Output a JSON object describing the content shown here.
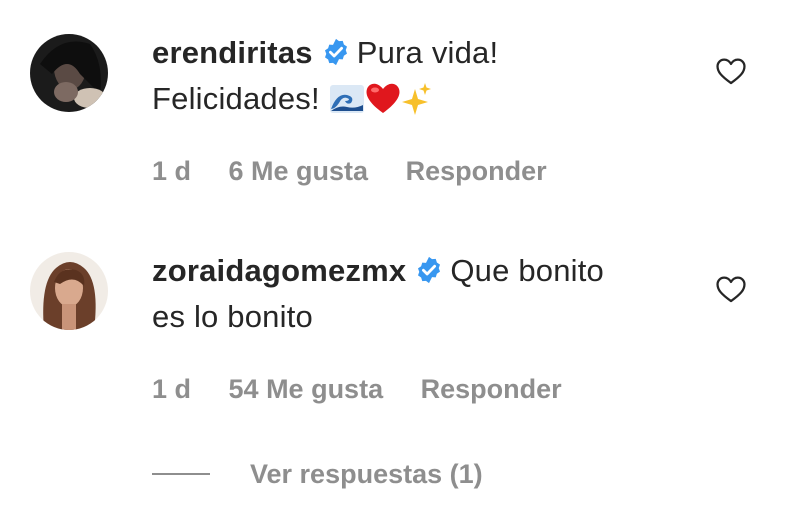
{
  "comments": [
    {
      "username": "erendiritas",
      "text_line1": "Pura vida!",
      "text_line2": "Felicidades!",
      "time": "1 d",
      "likes": "6 Me gusta",
      "reply": "Responder"
    },
    {
      "username": "zoraidagomezmx",
      "text_line1": "Que bonito",
      "text_line2": "es lo bonito",
      "time": "1 d",
      "likes": "54 Me gusta",
      "reply": "Responder"
    }
  ],
  "view_replies": "Ver respuestas (1)",
  "icons": {
    "verified": "verified-badge-icon",
    "like": "heart-outline-icon"
  },
  "colors": {
    "verified": "#3897f0",
    "secondary_text": "#8e8e8e",
    "primary_text": "#262626"
  }
}
